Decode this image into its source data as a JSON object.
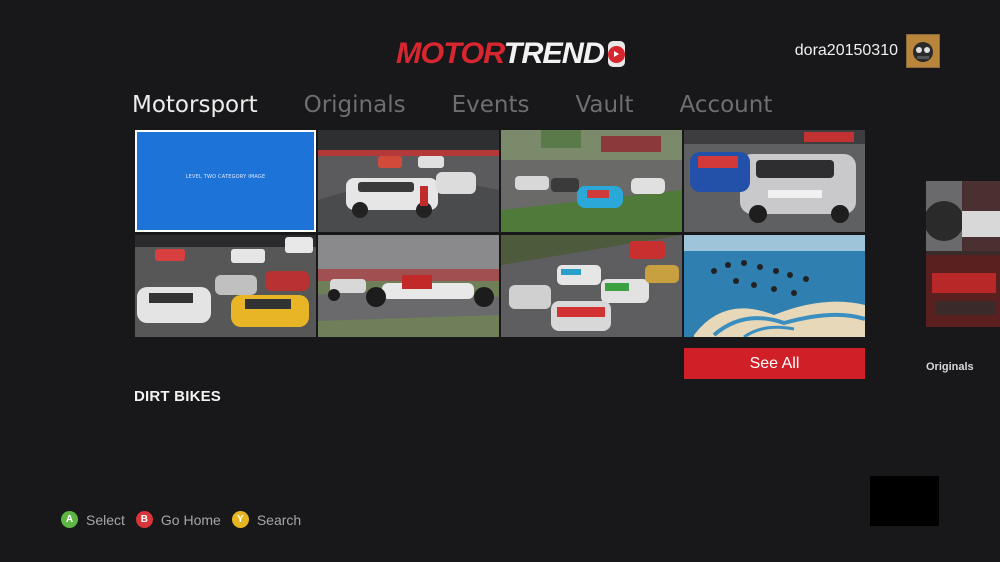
{
  "app": {
    "logo_part1": "MOTOR",
    "logo_part2": "TREND",
    "logo_icon": "play-button-icon"
  },
  "user": {
    "name": "dora20150310",
    "avatar_icon": "avatar-icon"
  },
  "nav": {
    "tabs": [
      {
        "label": "Motorsport",
        "active": true
      },
      {
        "label": "Originals",
        "active": false
      },
      {
        "label": "Events",
        "active": false
      },
      {
        "label": "Vault",
        "active": false
      },
      {
        "label": "Account",
        "active": false
      }
    ]
  },
  "grid": {
    "tiles": [
      {
        "caption": "LEVEL TWO CATEGORY IMAGE",
        "selected": true
      },
      {
        "caption": "",
        "scene": "porsche-race"
      },
      {
        "caption": "",
        "scene": "prototype-race"
      },
      {
        "caption": "",
        "scene": "touring-cars"
      },
      {
        "caption": "",
        "scene": "gt-race-pack"
      },
      {
        "caption": "",
        "scene": "formula-race"
      },
      {
        "caption": "",
        "scene": "audi-gt-race"
      },
      {
        "caption": "",
        "scene": "skydivers-palm-island"
      }
    ],
    "see_all_label": "See All"
  },
  "section": {
    "title": "DIRT BIKES"
  },
  "side_panel": {
    "label": "Originals"
  },
  "footer": {
    "hints": [
      {
        "button": "A",
        "label": "Select",
        "color": "#5db543"
      },
      {
        "button": "B",
        "label": "Go Home",
        "color": "#d9343a"
      },
      {
        "button": "Y",
        "label": "Search",
        "color": "#e6b521"
      }
    ]
  },
  "colors": {
    "accent": "#d11f27",
    "selection": "#1d73d8",
    "background": "#18181a"
  }
}
